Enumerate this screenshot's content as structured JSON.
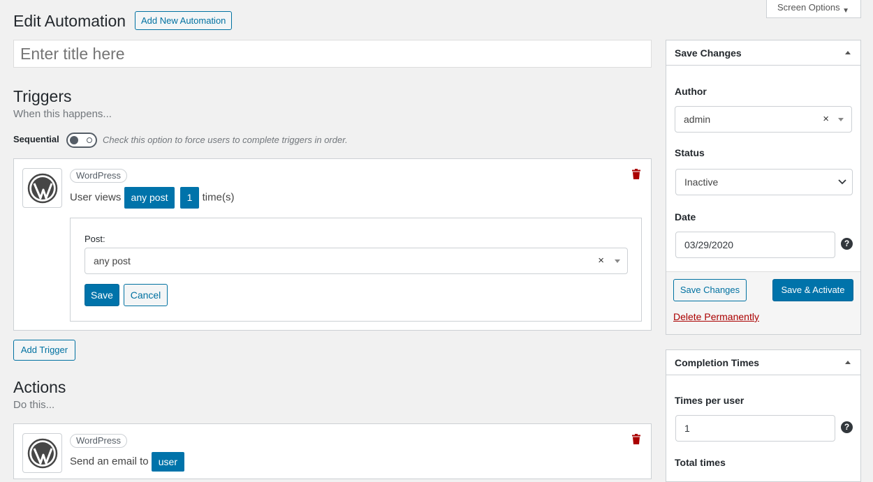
{
  "header": {
    "title": "Edit Automation",
    "add_new_label": "Add New Automation",
    "screen_options_label": "Screen Options"
  },
  "title_input": {
    "placeholder": "Enter title here"
  },
  "triggers": {
    "heading": "Triggers",
    "subheading": "When this happens...",
    "sequential_label": "Sequential",
    "sequential_enabled": false,
    "sequential_help": "Check this option to force users to complete triggers in order.",
    "items": [
      {
        "integration": "WordPress",
        "icon": "wordpress-icon",
        "sentence_prefix": "User views",
        "post_tag": "any post",
        "count_tag": "1",
        "sentence_suffix": "time(s)",
        "form": {
          "post_label": "Post:",
          "post_value": "any post",
          "save_label": "Save",
          "cancel_label": "Cancel"
        }
      }
    ],
    "add_label": "Add Trigger"
  },
  "actions": {
    "heading": "Actions",
    "subheading": "Do this...",
    "items": [
      {
        "integration": "WordPress",
        "icon": "wordpress-icon",
        "sentence_prefix": "Send an email to",
        "user_tag": "user"
      }
    ]
  },
  "sidebar": {
    "save_box": {
      "title": "Save Changes",
      "author_label": "Author",
      "author_value": "admin",
      "status_label": "Status",
      "status_value": "Inactive",
      "date_label": "Date",
      "date_value": "03/29/2020",
      "save_changes_label": "Save Changes",
      "save_activate_label": "Save & Activate",
      "delete_label": "Delete Permanently"
    },
    "completion_box": {
      "title": "Completion Times",
      "times_per_user_label": "Times per user",
      "times_per_user_value": "1",
      "total_times_label": "Total times"
    }
  },
  "colors": {
    "primary": "#0073aa",
    "danger": "#a00",
    "background": "#f1f1f1"
  }
}
